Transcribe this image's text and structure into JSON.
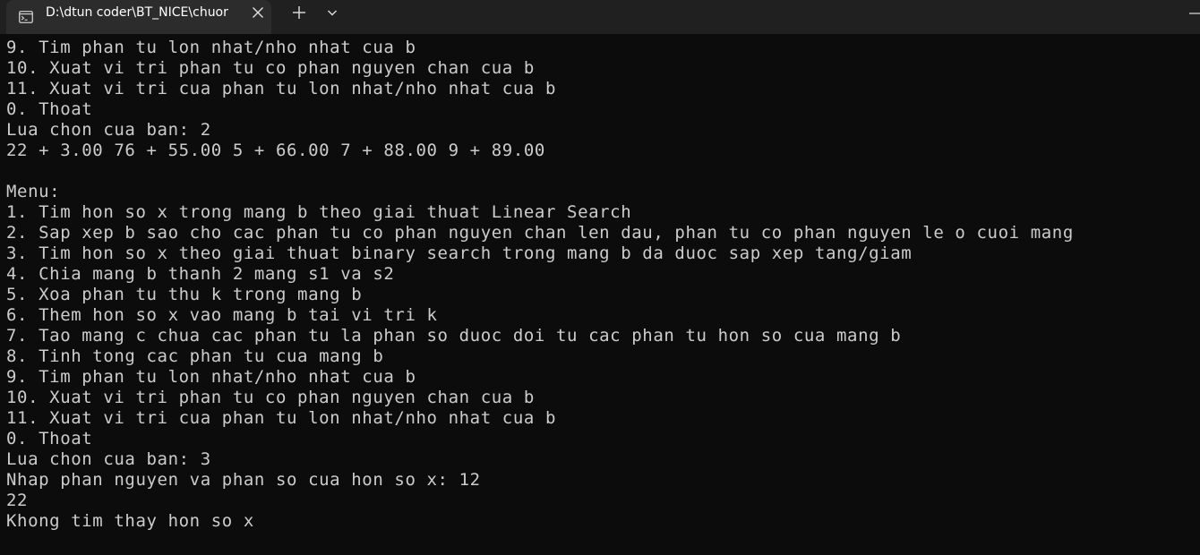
{
  "window": {
    "tab_title": "D:\\dtun coder\\BT_NICE\\chuor",
    "tab_icon": "terminal-icon",
    "close_icon": "close-icon",
    "new_tab_icon": "plus-icon",
    "dropdown_icon": "chevron-down-icon",
    "minimize_icon": "minimize-icon"
  },
  "colors": {
    "background": "#0c0c0c",
    "text": "#cccccc",
    "tabbar": "#202020",
    "active_tab": "#2c2c2c"
  },
  "console": {
    "lines": [
      "9. Tim phan tu lon nhat/nho nhat cua b",
      "10. Xuat vi tri phan tu co phan nguyen chan cua b",
      "11. Xuat vi tri cua phan tu lon nhat/nho nhat cua b",
      "0. Thoat",
      "Lua chon cua ban: 2",
      "22 + 3.00 76 + 55.00 5 + 66.00 7 + 88.00 9 + 89.00",
      "",
      "Menu:",
      "1. Tim hon so x trong mang b theo giai thuat Linear Search",
      "2. Sap xep b sao cho cac phan tu co phan nguyen chan len dau, phan tu co phan nguyen le o cuoi mang",
      "3. Tim hon so x theo giai thuat binary search trong mang b da duoc sap xep tang/giam",
      "4. Chia mang b thanh 2 mang s1 va s2",
      "5. Xoa phan tu thu k trong mang b",
      "6. Them hon so x vao mang b tai vi tri k",
      "7. Tao mang c chua cac phan tu la phan so duoc doi tu cac phan tu hon so cua mang b",
      "8. Tinh tong cac phan tu cua mang b",
      "9. Tim phan tu lon nhat/nho nhat cua b",
      "10. Xuat vi tri phan tu co phan nguyen chan cua b",
      "11. Xuat vi tri cua phan tu lon nhat/nho nhat cua b",
      "0. Thoat",
      "Lua chon cua ban: 3",
      "Nhap phan nguyen va phan so cua hon so x: 12",
      "22",
      "Khong tim thay hon so x"
    ]
  }
}
